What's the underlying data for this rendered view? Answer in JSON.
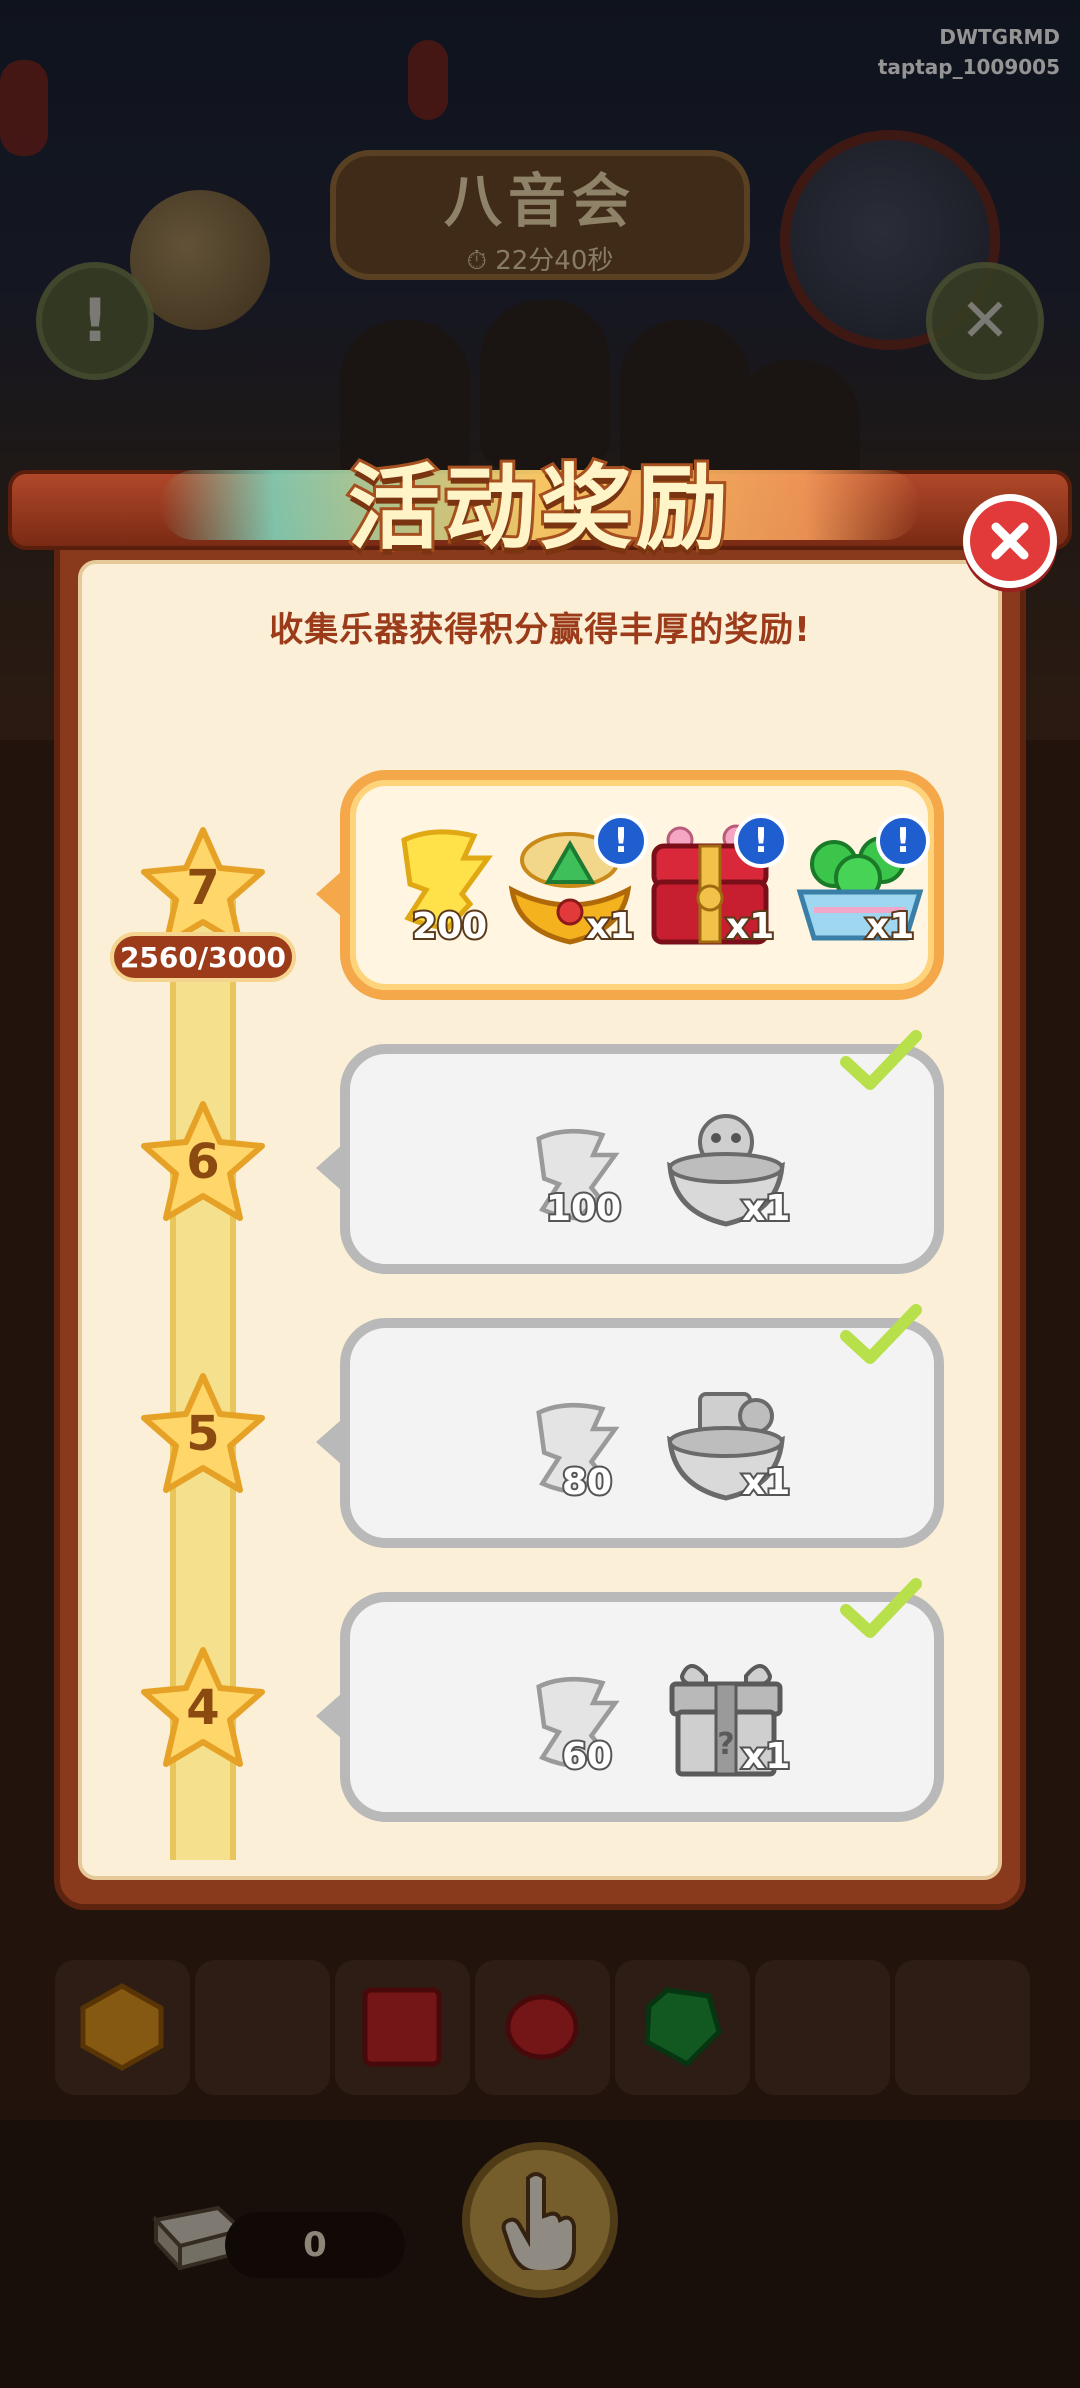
{
  "hud": {
    "title": "八音会",
    "timer": "22分40秒",
    "watermark_line1": "DWTGRMD",
    "watermark_line2": "taptap_1009005",
    "collected_count": "0"
  },
  "modal": {
    "title": "活动奖励",
    "subtitle": "收集乐器获得积分赢得丰厚的奖励!",
    "progress": "2560/3000",
    "progress_value": 2560,
    "progress_target": 3000
  },
  "tiers": [
    {
      "level": "7",
      "state": "current",
      "rewards": [
        {
          "icon": "gold-token-icon",
          "qty": "200"
        },
        {
          "icon": "golden-treasure-bowl-icon",
          "qty": "x1",
          "info": "!"
        },
        {
          "icon": "red-gift-chest-icon",
          "qty": "x1",
          "info": "!"
        },
        {
          "icon": "green-coin-basket-icon",
          "qty": "x1",
          "info": "!"
        }
      ]
    },
    {
      "level": "6",
      "state": "claimed",
      "rewards": [
        {
          "icon": "silver-token-icon",
          "qty": "100"
        },
        {
          "icon": "silver-lion-bowl-icon",
          "qty": "x1"
        }
      ]
    },
    {
      "level": "5",
      "state": "claimed",
      "rewards": [
        {
          "icon": "silver-token-icon",
          "qty": "80"
        },
        {
          "icon": "silver-treasure-bowl-icon",
          "qty": "x1"
        }
      ]
    },
    {
      "level": "4",
      "state": "claimed",
      "rewards": [
        {
          "icon": "silver-token-icon",
          "qty": "60"
        },
        {
          "icon": "silver-gift-box-icon",
          "qty": "x1"
        }
      ]
    }
  ],
  "colors": {
    "accent": "#f4a84a",
    "claimed_border": "#b9b9b9",
    "frame": "#8a3a1c",
    "subtitle": "#9b3b1a"
  }
}
